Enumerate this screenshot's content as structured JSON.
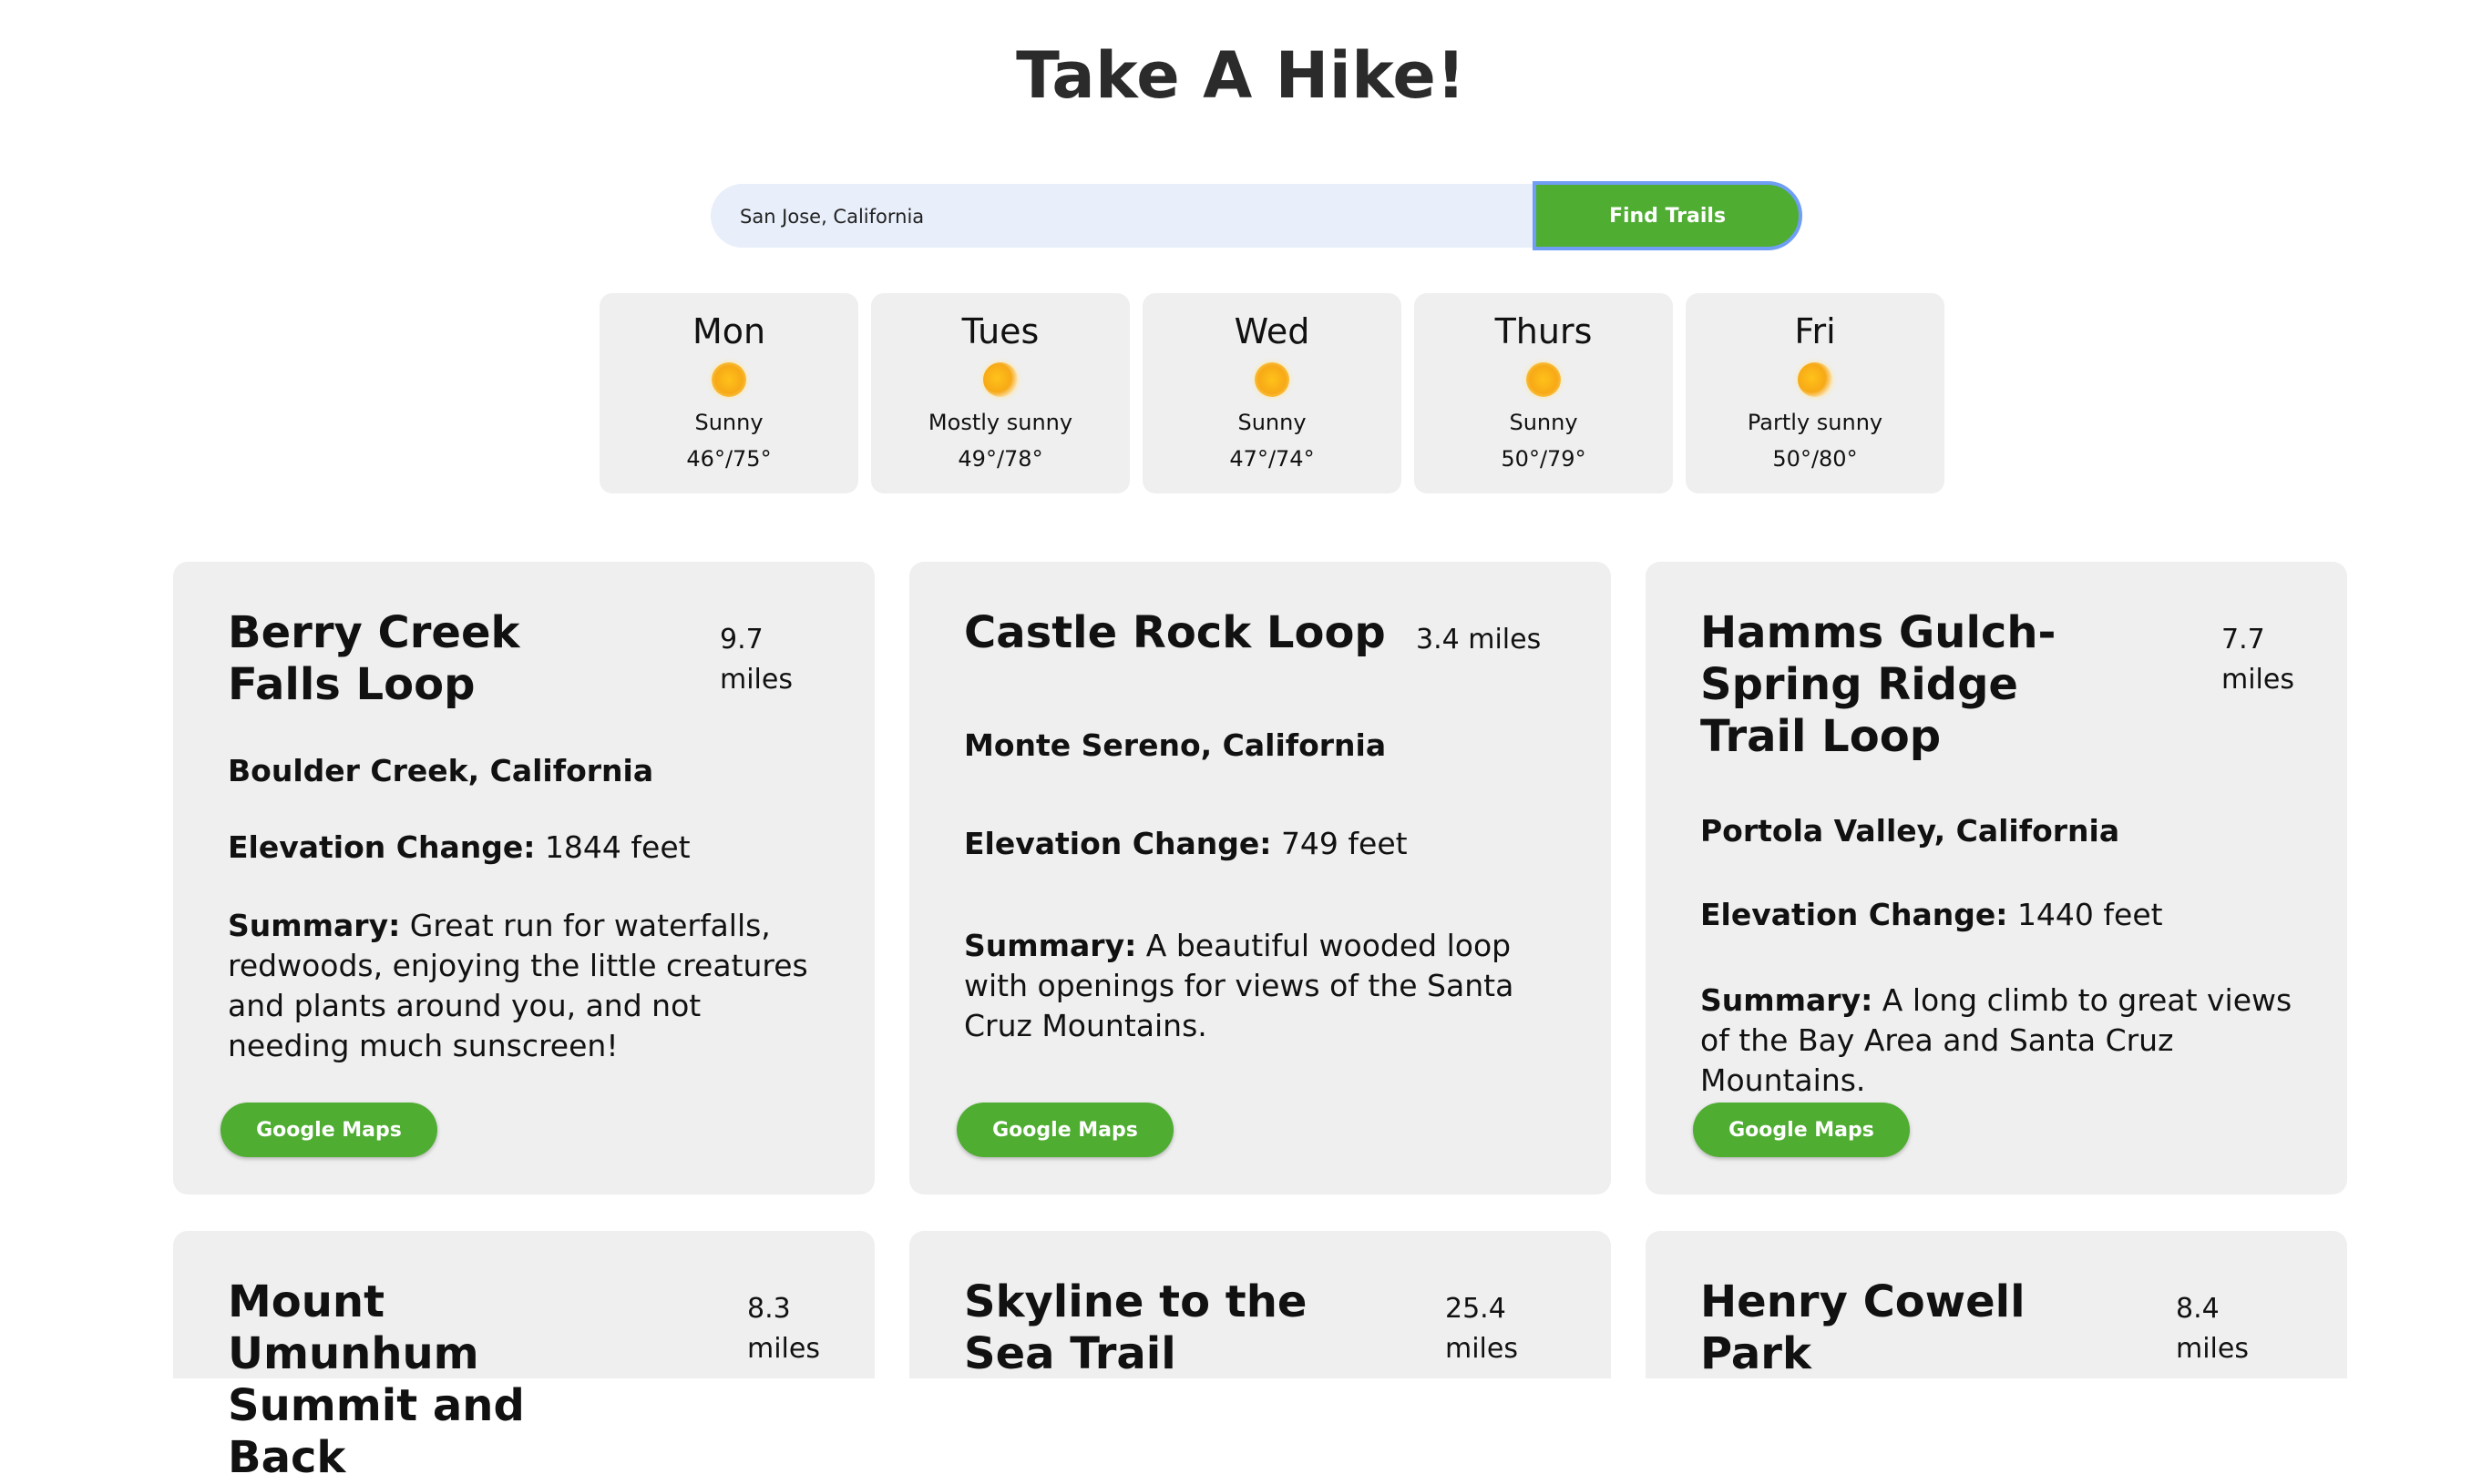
{
  "header": {
    "title": "Take A Hike!"
  },
  "search": {
    "value": "San Jose, California",
    "button_label": "Find Trails"
  },
  "forecast": [
    {
      "day": "Mon",
      "icon": "sun-icon",
      "condition": "Sunny",
      "temps": "46°/75°"
    },
    {
      "day": "Tues",
      "icon": "mostly-sunny-icon",
      "condition": "Mostly sunny",
      "temps": "49°/78°"
    },
    {
      "day": "Wed",
      "icon": "sun-icon",
      "condition": "Sunny",
      "temps": "47°/74°"
    },
    {
      "day": "Thurs",
      "icon": "sun-icon",
      "condition": "Sunny",
      "temps": "50°/79°"
    },
    {
      "day": "Fri",
      "icon": "partly-sunny-icon",
      "condition": "Partly sunny",
      "temps": "50°/80°"
    }
  ],
  "labels": {
    "elevation": "Elevation Change:",
    "summary": "Summary:",
    "maps_button": "Google Maps"
  },
  "trails": [
    {
      "name": "Berry Creek Falls Loop",
      "miles": "9.7 miles",
      "location": "Boulder Creek, California",
      "elevation": "1844 feet",
      "summary": "Great run for waterfalls, redwoods, enjoying the little creatures and plants around you, and not needing much sunscreen!"
    },
    {
      "name": "Castle Rock Loop",
      "miles": "3.4 miles",
      "location": "Monte Sereno, California",
      "elevation": "749 feet",
      "summary": "A beautiful wooded loop with openings for views of the Santa Cruz Mountains."
    },
    {
      "name": "Hamms Gulch-Spring Ridge Trail Loop",
      "miles": "7.7 miles",
      "location": "Portola Valley, California",
      "elevation": "1440 feet",
      "summary": "A long climb to great views of the Bay Area and Santa Cruz Mountains."
    },
    {
      "name": "Mount Umunhum Summit and Back",
      "miles": "8.3 miles"
    },
    {
      "name": "Skyline to the Sea Trail",
      "miles": "25.4 miles"
    },
    {
      "name": "Henry Cowell Park",
      "miles": "8.4 miles"
    }
  ],
  "colors": {
    "accent_green": "#4fad32",
    "card_bg": "#efefef",
    "search_bg": "#e8eefa",
    "focus_ring": "#6f9ef4"
  }
}
